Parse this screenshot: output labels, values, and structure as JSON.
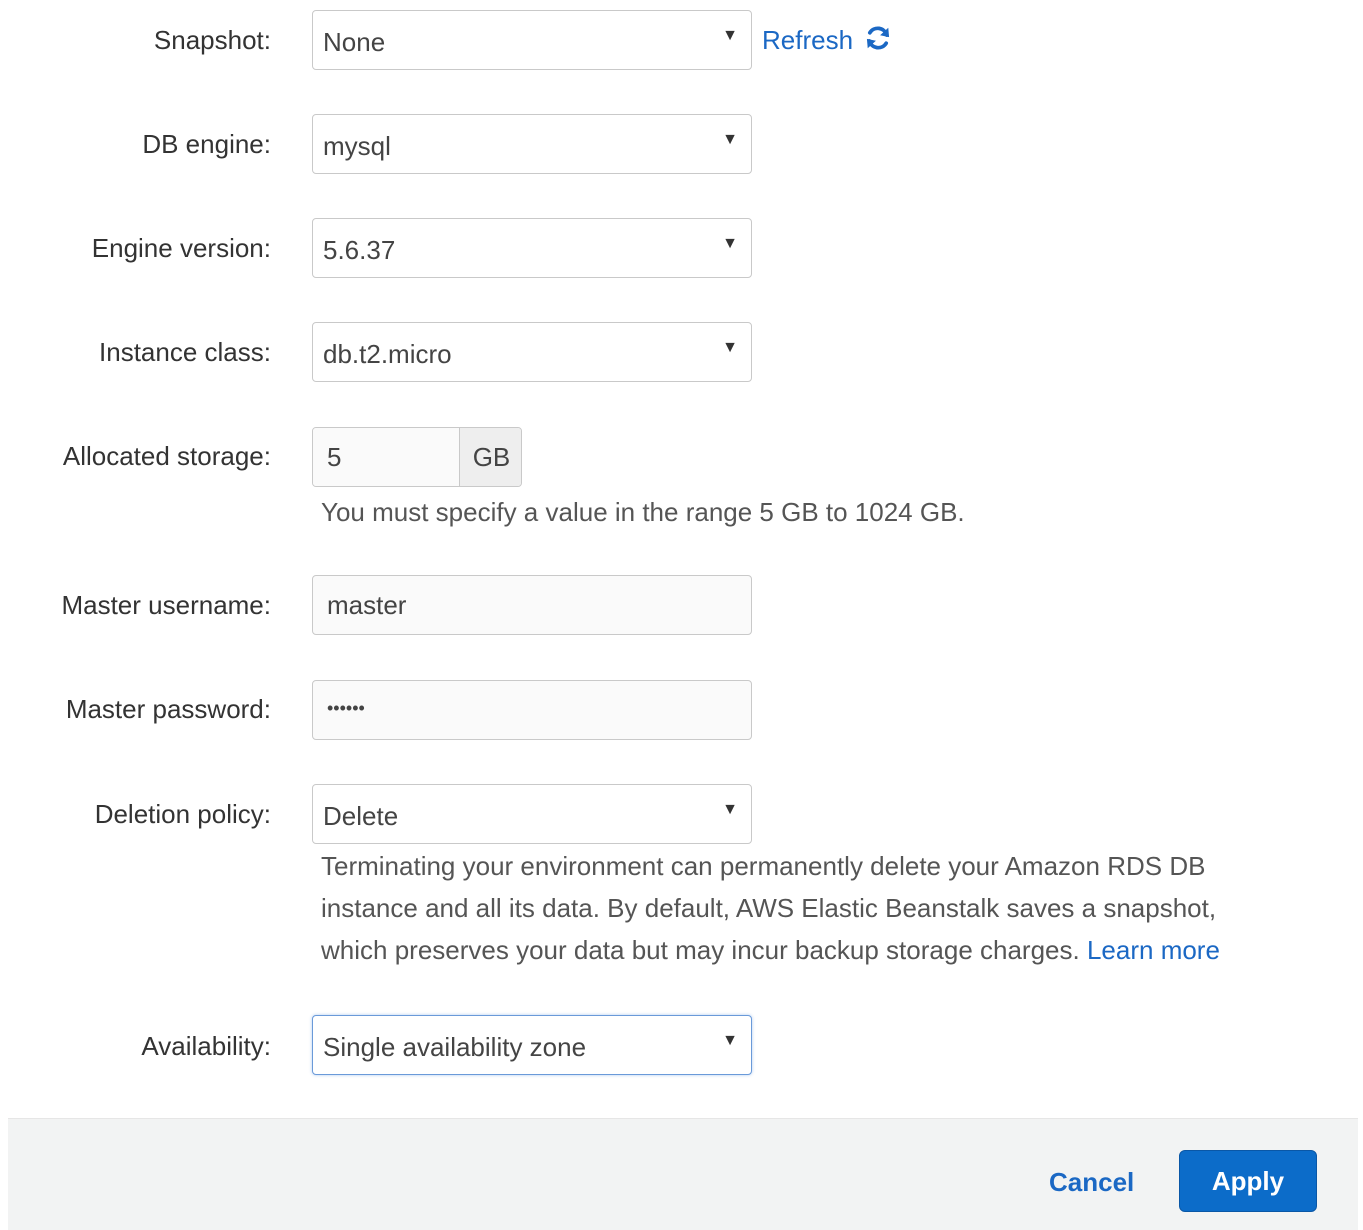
{
  "form": {
    "snapshot": {
      "label": "Snapshot:",
      "value": "None",
      "refresh_label": "Refresh"
    },
    "db_engine": {
      "label": "DB engine:",
      "value": "mysql"
    },
    "engine_version": {
      "label": "Engine version:",
      "value": "5.6.37"
    },
    "instance_class": {
      "label": "Instance class:",
      "value": "db.t2.micro"
    },
    "allocated_storage": {
      "label": "Allocated storage:",
      "value": "5",
      "unit": "GB",
      "help": "You must specify a value in the range 5 GB to 1024 GB."
    },
    "master_username": {
      "label": "Master username:",
      "value": "master"
    },
    "master_password": {
      "label": "Master password:",
      "value": "••••••"
    },
    "deletion_policy": {
      "label": "Deletion policy:",
      "value": "Delete",
      "help_line1": "Terminating your environment can permanently delete your Amazon RDS DB",
      "help_line2": "instance and all its data. By default, AWS Elastic Beanstalk saves a snapshot,",
      "help_line3": "which preserves your data but may incur backup storage charges.",
      "learn_more": "Learn more"
    },
    "availability": {
      "label": "Availability:",
      "value": "Single availability zone"
    }
  },
  "footer": {
    "cancel_label": "Cancel",
    "apply_label": "Apply"
  },
  "colors": {
    "link": "#1b68c4",
    "primary_button": "#0c6cc9",
    "footer_bg": "#f2f3f3"
  }
}
